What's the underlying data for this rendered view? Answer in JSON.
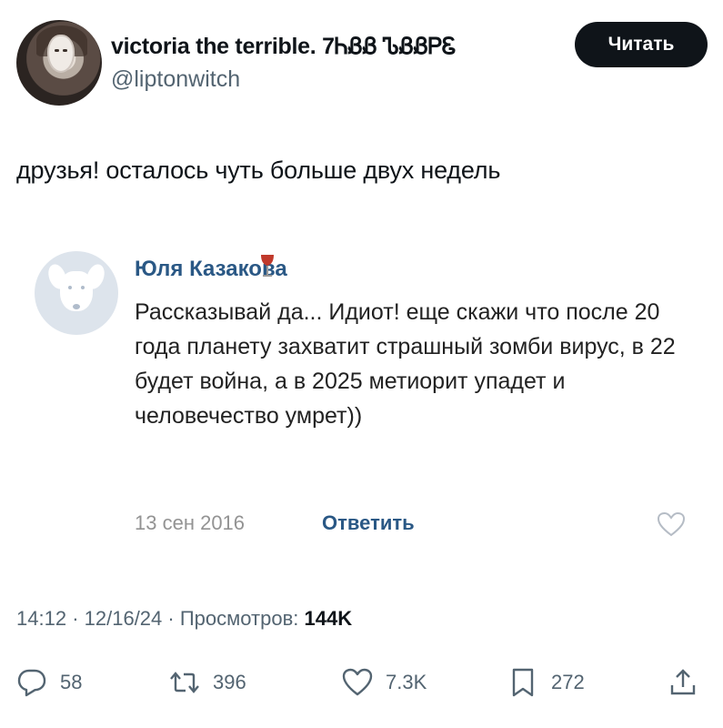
{
  "author": {
    "name": "victoria the terrible. 7ᏂᏰᏰ ᏖᏰᏰᏢᏋ",
    "handle": "@liptonwitch",
    "follow_label": "Читать"
  },
  "tweet": {
    "text": "друзья! осталось чуть больше двух недель"
  },
  "embedded_comment": {
    "author": "Юля Казакова",
    "text": "Рассказывай да... Идиот! еще скажи что после 20 года планету захватит страшный зомби вирус, в 22 будет война, а в 2025 метиорит упадет и человечество умрет))",
    "date": "13 сен 2016",
    "reply_label": "Ответить"
  },
  "meta": {
    "time": "14:12",
    "date": "12/16/24",
    "views_label": "Просмотров:",
    "views": "144K"
  },
  "actions": {
    "replies": "58",
    "reposts": "396",
    "likes": "7.3K",
    "bookmarks": "272"
  },
  "colors": {
    "text": "#0f1419",
    "muted": "#536471",
    "vk_link": "#2a5885"
  }
}
